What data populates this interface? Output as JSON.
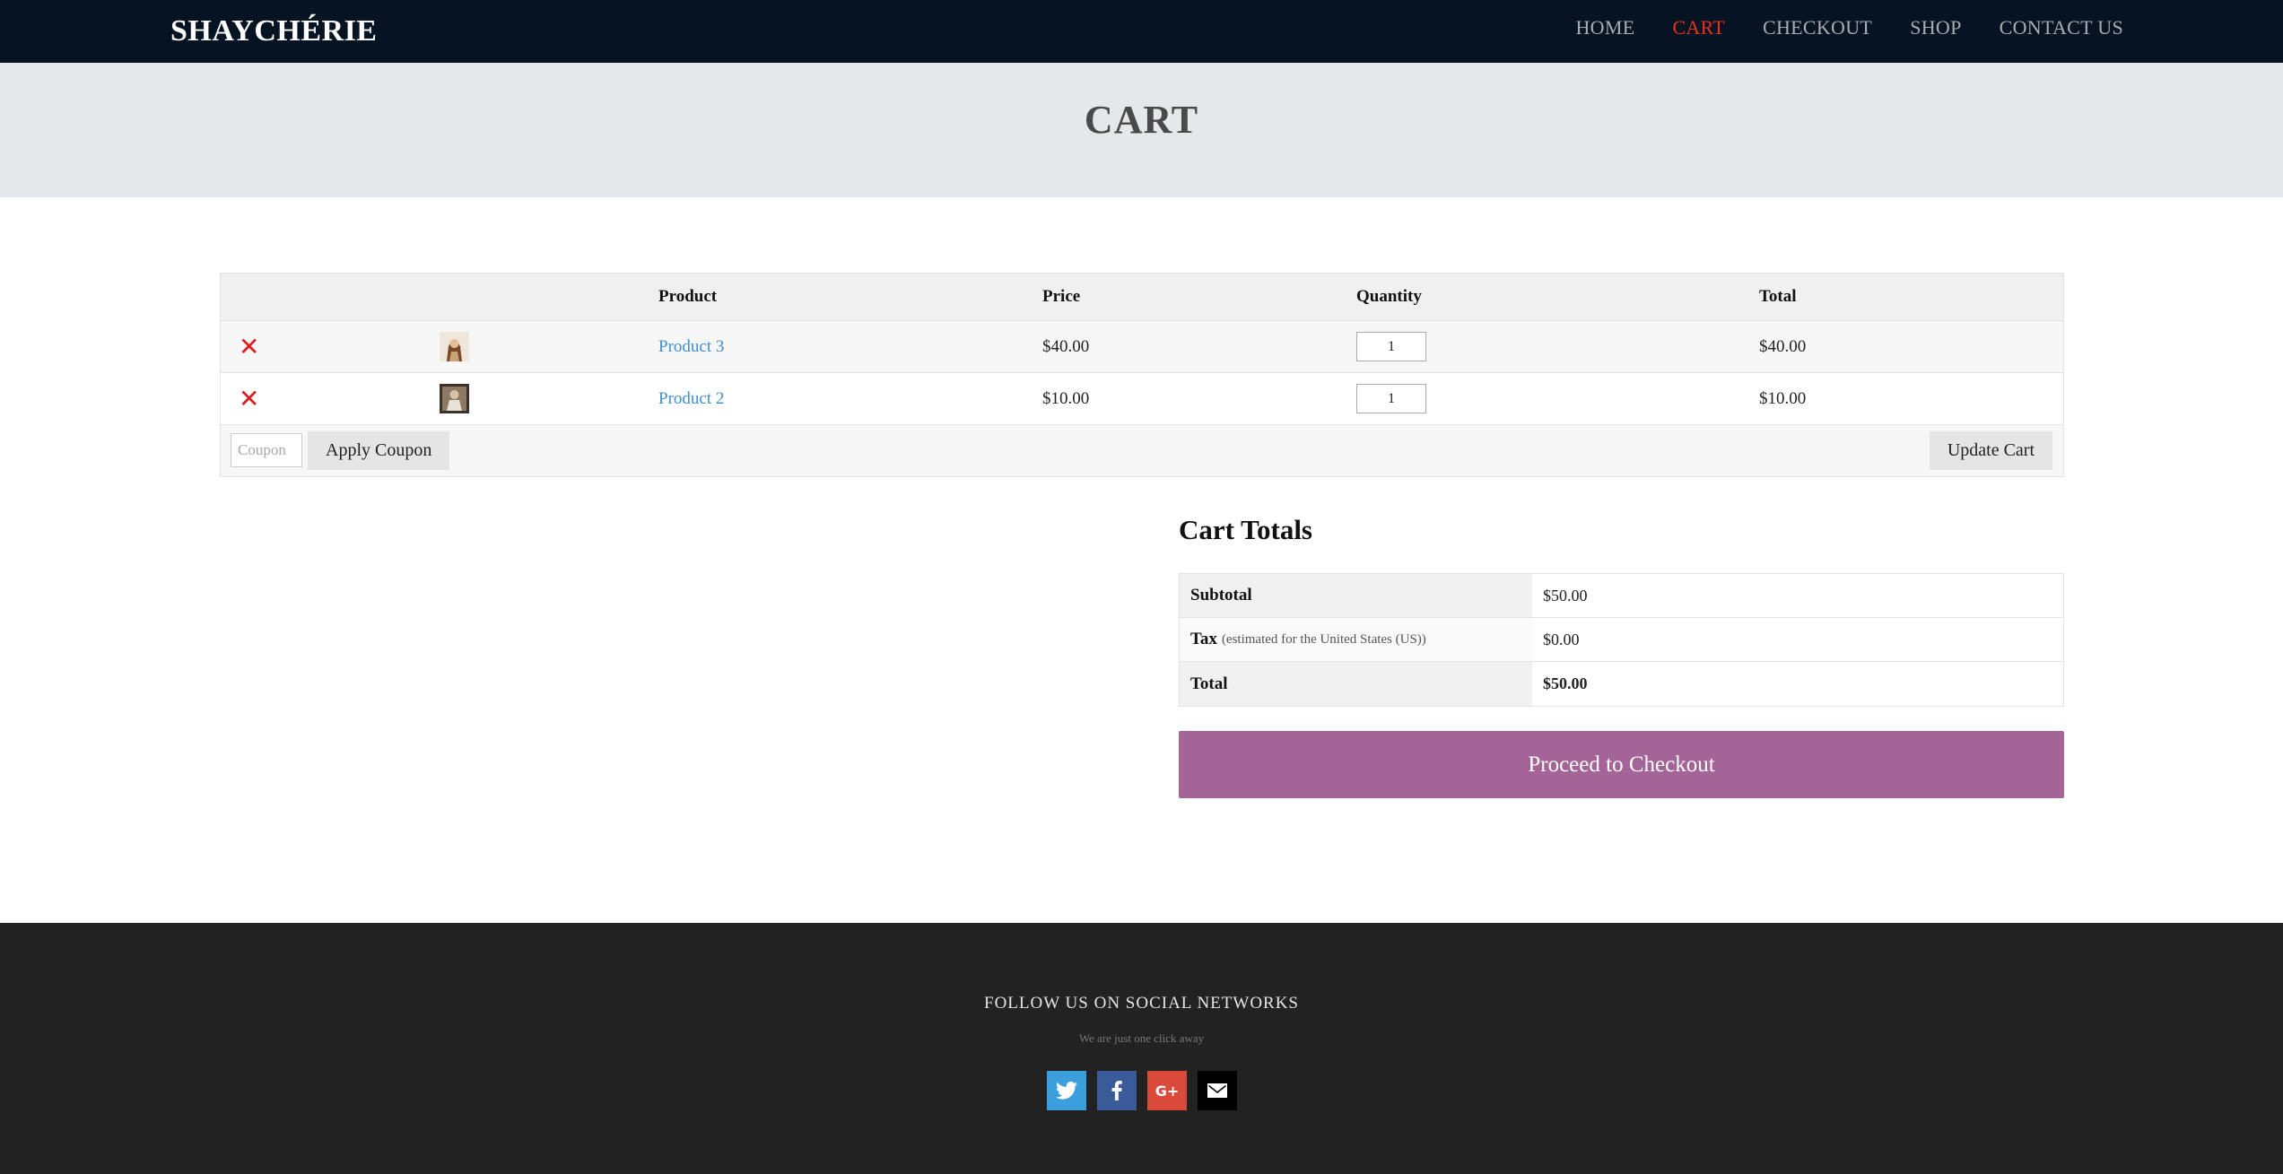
{
  "site": {
    "brand": "SHAYCHÉRIE"
  },
  "nav": {
    "items": [
      {
        "label": "HOME",
        "active": false
      },
      {
        "label": "CART",
        "active": true
      },
      {
        "label": "CHECKOUT",
        "active": false
      },
      {
        "label": "SHOP",
        "active": false
      },
      {
        "label": "CONTACT US",
        "active": false
      }
    ]
  },
  "hero": {
    "title": "CART"
  },
  "cart": {
    "columns": {
      "product": "Product",
      "price": "Price",
      "quantity": "Quantity",
      "total": "Total"
    },
    "items": [
      {
        "name": "Product 3",
        "price": "$40.00",
        "quantity": "1",
        "total": "$40.00",
        "remove_icon": "remove-x-icon"
      },
      {
        "name": "Product 2",
        "price": "$10.00",
        "quantity": "1",
        "total": "$10.00",
        "remove_icon": "remove-x-icon"
      }
    ],
    "coupon_placeholder": "Coupon",
    "apply_coupon_label": "Apply Coupon",
    "update_cart_label": "Update Cart"
  },
  "totals": {
    "title": "Cart Totals",
    "subtotal_label": "Subtotal",
    "subtotal_value": "$50.00",
    "tax_label": "Tax",
    "tax_note": "(estimated for the United States (US))",
    "tax_value": "$0.00",
    "total_label": "Total",
    "total_value": "$50.00",
    "checkout_label": "Proceed to Checkout"
  },
  "footer": {
    "follow": "FOLLOW US ON SOCIAL NETWORKS",
    "tagline": "We are just one click away",
    "socials": [
      "twitter-icon",
      "facebook-icon",
      "google-plus-icon",
      "email-icon"
    ],
    "google_plus_glyph": "G+"
  },
  "colors": {
    "nav_bg": "#051322",
    "nav_active": "#e8321e",
    "link": "#3f8fd1",
    "checkout": "#a46497",
    "remove": "#e01b1b",
    "footer_bg": "#222222",
    "twitter": "#3b9fdd",
    "facebook": "#3b5a9a",
    "google_plus": "#d94a3a"
  }
}
